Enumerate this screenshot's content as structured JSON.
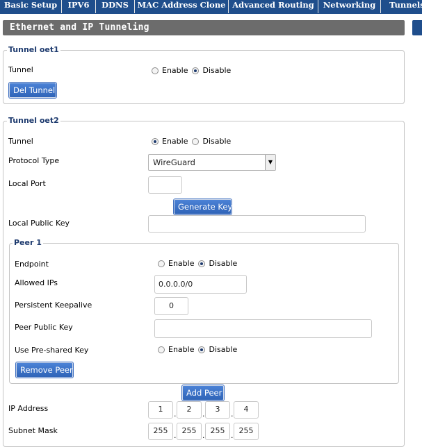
{
  "tabs": [
    {
      "label": "Basic Setup"
    },
    {
      "label": "IPV6"
    },
    {
      "label": "DDNS"
    },
    {
      "label": "MAC Address Clone"
    },
    {
      "label": "Advanced Routing"
    },
    {
      "label": "Networking"
    },
    {
      "label": "Tunnels"
    }
  ],
  "section_title": "Ethernet and IP Tunneling",
  "tunnel1": {
    "legend": "Tunnel oet1",
    "tunnel_label": "Tunnel",
    "enable_label": "Enable",
    "disable_label": "Disable",
    "tunnel_state": "Disable",
    "del_button": "Del Tunnel"
  },
  "tunnel2": {
    "legend": "Tunnel oet2",
    "tunnel_label": "Tunnel",
    "enable_label": "Enable",
    "disable_label": "Disable",
    "tunnel_state": "Enable",
    "protocol_label": "Protocol Type",
    "protocol_value": "WireGuard",
    "local_port_label": "Local Port",
    "local_port_value": "",
    "generate_key_button": "Generate Key",
    "local_public_key_label": "Local Public Key",
    "local_public_key_value": "",
    "peer1": {
      "legend": "Peer 1",
      "endpoint_label": "Endpoint",
      "endpoint_state": "Disable",
      "allowed_ips_label": "Allowed IPs",
      "allowed_ips_value": "0.0.0.0/0",
      "keepalive_label": "Persistent Keepalive",
      "keepalive_value": "0",
      "peer_public_key_label": "Peer Public Key",
      "peer_public_key_value": "",
      "psk_label": "Use Pre-shared Key",
      "psk_state": "Disable",
      "remove_button": "Remove Peer"
    },
    "add_peer_button": "Add Peer",
    "ip_address_label": "IP Address",
    "ip_address": [
      "1",
      "2",
      "3",
      "4"
    ],
    "subnet_mask_label": "Subnet Mask",
    "subnet_mask": [
      "255",
      "255",
      "255",
      "255"
    ],
    "dot": "."
  },
  "icons": {
    "dropdown": "chevron-down-icon"
  },
  "colors": {
    "tab_bar": "#1f4e8c",
    "header_bg": "#6c6c6c",
    "legend": "#1d3a6e",
    "button": "#2f64b8"
  }
}
